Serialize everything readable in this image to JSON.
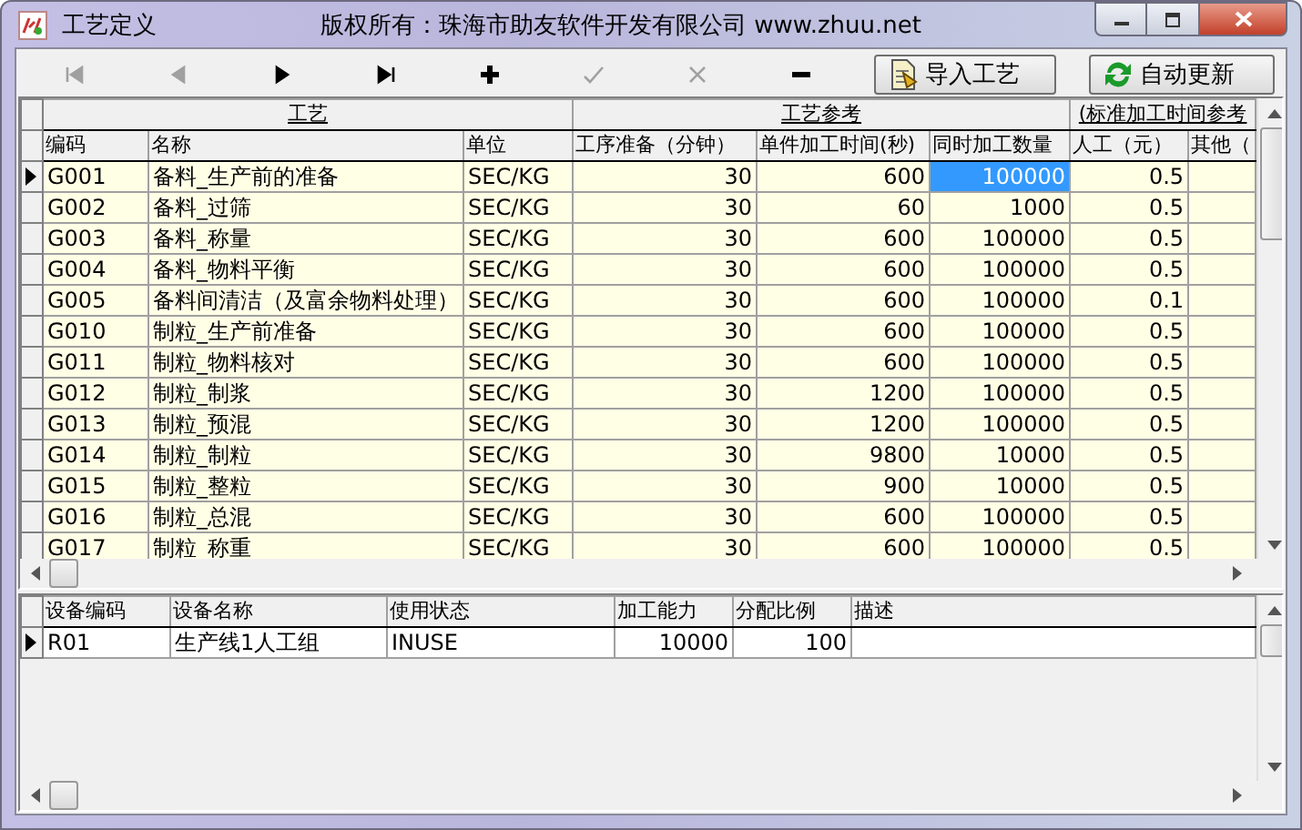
{
  "window": {
    "title": "工艺定义",
    "copyright": "版权所有：珠海市助友软件开发有限公司 www.zhuu.net"
  },
  "toolbar": {
    "nav": [
      {
        "kind": "first",
        "disabled": true
      },
      {
        "kind": "prev",
        "disabled": true
      },
      {
        "kind": "next",
        "disabled": false
      },
      {
        "kind": "last",
        "disabled": false
      },
      {
        "kind": "add",
        "disabled": false
      },
      {
        "kind": "post",
        "disabled": true
      },
      {
        "kind": "cancel",
        "disabled": true
      },
      {
        "kind": "delete",
        "disabled": false
      }
    ],
    "buttons": [
      {
        "kind": "import",
        "label": "导入工艺"
      },
      {
        "kind": "refresh",
        "label": "自动更新"
      }
    ]
  },
  "process_table": {
    "groups": [
      {
        "label": "工艺"
      },
      {
        "label": "工艺参考"
      },
      {
        "label": "(标准加工时间参考"
      }
    ],
    "columns": [
      {
        "label": "编码",
        "kind": "text",
        "current": false
      },
      {
        "label": "名称",
        "kind": "text",
        "current": false
      },
      {
        "label": "单位",
        "kind": "text",
        "current": false
      },
      {
        "label": "工序准备（分钟）",
        "kind": "number",
        "current": false
      },
      {
        "label": "单件加工时间(秒)",
        "kind": "number",
        "current": false
      },
      {
        "label": "同时加工数量",
        "kind": "number",
        "current": true
      },
      {
        "label": "人工（元）",
        "kind": "number",
        "current": false
      },
      {
        "label": "其他（",
        "kind": "number",
        "current": false
      }
    ],
    "rows": [
      {
        "selected": true,
        "cells": [
          "G001",
          "备料_生产前的准备",
          "SEC/KG",
          "30",
          "600",
          "100000",
          "0.5"
        ]
      },
      {
        "selected": false,
        "cells": [
          "G002",
          "备料_过筛",
          "SEC/KG",
          "30",
          "60",
          "1000",
          "0.5"
        ]
      },
      {
        "selected": false,
        "cells": [
          "G003",
          "备料_称量",
          "SEC/KG",
          "30",
          "600",
          "100000",
          "0.5"
        ]
      },
      {
        "selected": false,
        "cells": [
          "G004",
          "备料_物料平衡",
          "SEC/KG",
          "30",
          "600",
          "100000",
          "0.5"
        ]
      },
      {
        "selected": false,
        "cells": [
          "G005",
          "备料间清洁（及富余物料处理）",
          "SEC/KG",
          "30",
          "600",
          "100000",
          "0.1"
        ]
      },
      {
        "selected": false,
        "cells": [
          "G010",
          "制粒_生产前准备",
          "SEC/KG",
          "30",
          "600",
          "100000",
          "0.5"
        ]
      },
      {
        "selected": false,
        "cells": [
          "G011",
          "制粒_物料核对",
          "SEC/KG",
          "30",
          "600",
          "100000",
          "0.5"
        ]
      },
      {
        "selected": false,
        "cells": [
          "G012",
          "制粒_制浆",
          "SEC/KG",
          "30",
          "1200",
          "100000",
          "0.5"
        ]
      },
      {
        "selected": false,
        "cells": [
          "G013",
          "制粒_预混",
          "SEC/KG",
          "30",
          "1200",
          "100000",
          "0.5"
        ]
      },
      {
        "selected": false,
        "cells": [
          "G014",
          "制粒_制粒",
          "SEC/KG",
          "30",
          "9800",
          "10000",
          "0.5"
        ]
      },
      {
        "selected": false,
        "cells": [
          "G015",
          "制粒_整粒",
          "SEC/KG",
          "30",
          "900",
          "10000",
          "0.5"
        ]
      },
      {
        "selected": false,
        "cells": [
          "G016",
          "制粒_总混",
          "SEC/KG",
          "30",
          "600",
          "100000",
          "0.5"
        ]
      },
      {
        "selected": false,
        "cells": [
          "G017",
          "制粒_称重",
          "SEC/KG",
          "30",
          "600",
          "100000",
          "0.5"
        ]
      }
    ]
  },
  "equipment_table": {
    "columns": [
      {
        "label": "设备编码",
        "kind": "text"
      },
      {
        "label": "设备名称",
        "kind": "text"
      },
      {
        "label": "使用状态",
        "kind": "text"
      },
      {
        "label": "加工能力",
        "kind": "number"
      },
      {
        "label": "分配比例",
        "kind": "number"
      },
      {
        "label": "描述",
        "kind": "text"
      }
    ],
    "rows": [
      {
        "selected": true,
        "cells": [
          "R01",
          "生产线1人工组",
          "INUSE",
          "10000",
          "100"
        ]
      }
    ]
  }
}
